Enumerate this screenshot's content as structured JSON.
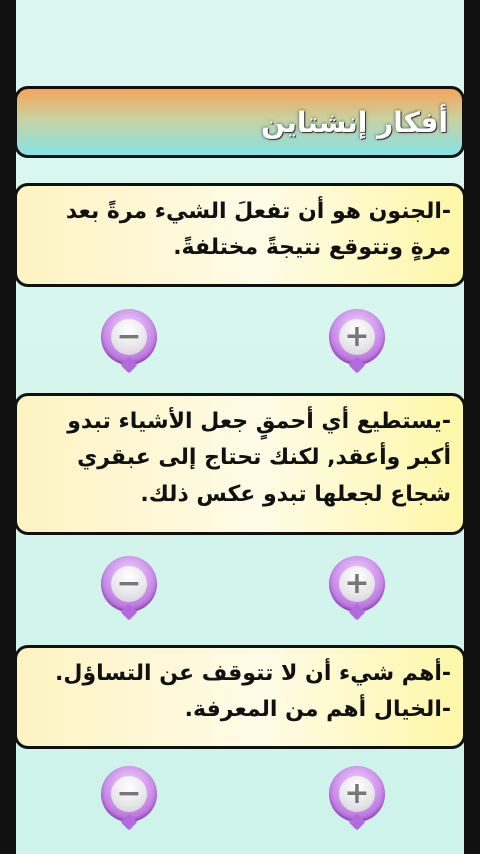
{
  "header": {
    "title": "أفكار إنشتاين"
  },
  "quotes": [
    {
      "text": "-الجنون هو أن تفعلَ الشيء مرةً بعد مرةٍ وتتوقع نتيجةً مختلفةً."
    },
    {
      "text": "-يستطيع أي أحمقٍ جعل الأشياء تبدو أكبر وأعقد, لكنك تحتاج إلى عبقري شجاع لجعلها تبدو عكس ذلك."
    },
    {
      "text": "-أهم شيء أن لا تتوقف عن التساؤل. -الخيال أهم من المعرفة."
    }
  ],
  "controls": {
    "minus_symbol": "−",
    "plus_symbol": "+"
  },
  "colors": {
    "accent_purple": "#b26bdc",
    "title_gradient_top": "#f5a55a",
    "title_gradient_bottom": "#86e3e8"
  }
}
